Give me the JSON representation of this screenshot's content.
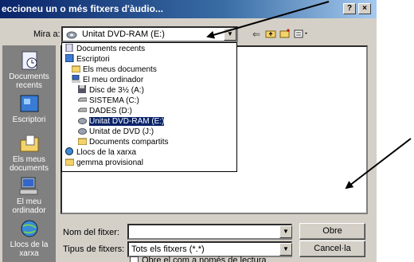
{
  "window": {
    "title": "eccioneu un o més fitxers d'àudio...",
    "help_label": "?",
    "close_label": "×"
  },
  "toolbar": {
    "look_in_label": "Mira a:",
    "look_in_value": "Unitat DVD-RAM (E:)",
    "back_icon": "back-arrow-icon",
    "up_icon": "up-folder-icon",
    "new_folder_icon": "new-folder-icon",
    "view_icon": "view-menu-icon"
  },
  "places": [
    {
      "label": "Documents recents",
      "icon": "recent-documents-icon"
    },
    {
      "label": "Escriptori",
      "icon": "desktop-icon"
    },
    {
      "label": "Els meus documents",
      "icon": "my-documents-icon"
    },
    {
      "label": "El meu ordinador",
      "icon": "my-computer-icon"
    },
    {
      "label": "Llocs de la xarxa",
      "icon": "network-places-icon"
    }
  ],
  "dropdown_items": [
    {
      "label": "Documents recents",
      "icon": "recent-documents-icon",
      "level": 0
    },
    {
      "label": "Escriptori",
      "icon": "desktop-icon",
      "level": 0
    },
    {
      "label": "Els meus documents",
      "icon": "folder-icon",
      "level": 1
    },
    {
      "label": "El meu ordinador",
      "icon": "computer-icon",
      "level": 1
    },
    {
      "label": "Disc de 3½ (A:)",
      "icon": "floppy-icon",
      "level": 2
    },
    {
      "label": "SISTEMA (C:)",
      "icon": "hard-drive-icon",
      "level": 2
    },
    {
      "label": "DADES (D:)",
      "icon": "hard-drive-icon",
      "level": 2
    },
    {
      "label": "Unitat DVD-RAM (E:)",
      "icon": "dvd-drive-icon",
      "level": 2,
      "selected": true
    },
    {
      "label": "Unitat de DVD (J:)",
      "icon": "dvd-drive-icon",
      "level": 2
    },
    {
      "label": "Documents compartits",
      "icon": "folder-icon",
      "level": 2
    },
    {
      "label": "Llocs de la xarxa",
      "icon": "network-icon",
      "level": 0
    },
    {
      "label": "gemma provisional",
      "icon": "folder-icon",
      "level": 0
    }
  ],
  "form": {
    "filename_label": "Nom del fitxer:",
    "filename_value": "",
    "filetype_label": "Tipus de fitxers:",
    "filetype_value": "Tots els fitxers (*.*)",
    "open_button": "Obre",
    "cancel_button": "Cancel·la",
    "checkbox_label": "Obre el com a només de lectura"
  },
  "colors": {
    "title_bar": "#0a246a",
    "selection": "#0a246a",
    "dialog_face": "#d4d0c8",
    "places_bar": "#808080"
  }
}
